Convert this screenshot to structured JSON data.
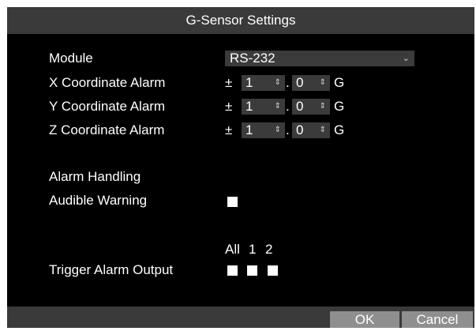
{
  "dialog": {
    "title": "G-Sensor Settings",
    "module": {
      "label": "Module",
      "value": "RS-232",
      "chevron": "⌄"
    },
    "coordinates": [
      {
        "label": "X Coordinate Alarm",
        "sign": "±",
        "int": "1",
        "sep": ".",
        "dec": "0",
        "unit": "G"
      },
      {
        "label": "Y Coordinate Alarm",
        "sign": "±",
        "int": "1",
        "sep": ".",
        "dec": "0",
        "unit": "G"
      },
      {
        "label": "Z Coordinate Alarm",
        "sign": "±",
        "int": "1",
        "sep": ".",
        "dec": "0",
        "unit": "G"
      }
    ],
    "spinner_glyph": "⇕",
    "alarm_handling": "Alarm Handling",
    "audible_warning": {
      "label": "Audible Warning",
      "checked": false
    },
    "trigger": {
      "label": "Trigger Alarm Output",
      "headers": [
        "All",
        "1",
        "2"
      ]
    },
    "buttons": {
      "ok": "OK",
      "cancel": "Cancel"
    }
  },
  "colors": {
    "background": "#000000",
    "titlebar": "#3a3a3a",
    "field": "#3b3b3b",
    "button": "#8f8f8f",
    "text": "#ffffff"
  }
}
